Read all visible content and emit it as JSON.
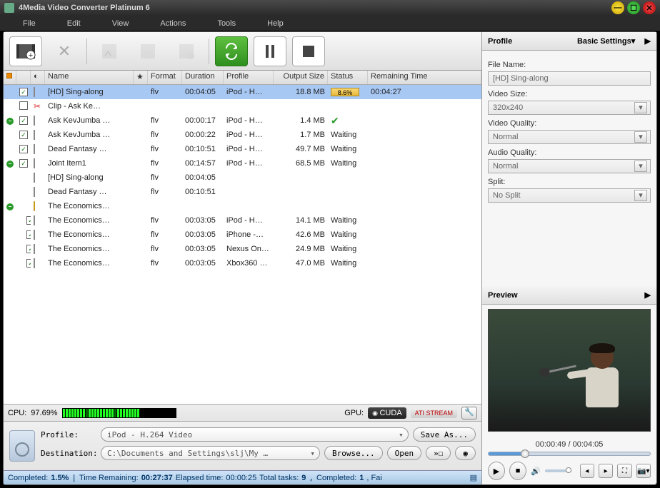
{
  "app": {
    "title": "4Media Video Converter Platinum 6"
  },
  "menu": {
    "file": "File",
    "edit": "Edit",
    "view": "View",
    "actions": "Actions",
    "tools": "Tools",
    "help": "Help"
  },
  "columns": {
    "name": "Name",
    "format": "Format",
    "duration": "Duration",
    "profile": "Profile",
    "output_size": "Output Size",
    "status": "Status",
    "remaining": "Remaining Time"
  },
  "rows": [
    {
      "exp": "",
      "chk": true,
      "type": "doc",
      "name": "[HD] Sing-along",
      "fmt": "flv",
      "dur": "00:04:05",
      "prof": "iPod - H…",
      "size": "18.8 MB",
      "stat_pct": "8.6%",
      "rem": "00:04:27",
      "sel": true
    },
    {
      "exp": "",
      "chk": false,
      "type": "scissor",
      "name": "Clip - Ask Ke…",
      "fmt": "",
      "dur": "",
      "prof": "",
      "size": "",
      "stat": "",
      "rem": ""
    },
    {
      "exp": "minus",
      "chk": true,
      "type": "doc",
      "name": "Ask KevJumba …",
      "fmt": "flv",
      "dur": "00:00:17",
      "prof": "iPod - H…",
      "size": "1.4 MB",
      "stat_ok": true,
      "rem": ""
    },
    {
      "exp": "",
      "chk": true,
      "type": "doc",
      "name": "Ask KevJumba …",
      "fmt": "flv",
      "dur": "00:00:22",
      "prof": "iPod - H…",
      "size": "1.7 MB",
      "stat": "Waiting",
      "rem": ""
    },
    {
      "exp": "",
      "chk": true,
      "type": "doc",
      "name": "Dead Fantasy …",
      "fmt": "flv",
      "dur": "00:10:51",
      "prof": "iPod - H…",
      "size": "49.7 MB",
      "stat": "Waiting",
      "rem": ""
    },
    {
      "exp": "minus",
      "chk": true,
      "type": "doc",
      "name": "Joint Item1",
      "fmt": "flv",
      "dur": "00:14:57",
      "prof": "iPod - H…",
      "size": "68.5 MB",
      "stat": "Waiting",
      "rem": ""
    },
    {
      "exp": "",
      "chk": false,
      "type": "doc",
      "name": "[HD] Sing-along",
      "fmt": "flv",
      "dur": "00:04:05",
      "prof": "",
      "size": "",
      "stat": "",
      "rem": "",
      "nochk": true
    },
    {
      "exp": "",
      "chk": false,
      "type": "doc",
      "name": "Dead Fantasy …",
      "fmt": "flv",
      "dur": "00:10:51",
      "prof": "",
      "size": "",
      "stat": "",
      "rem": "",
      "nochk": true
    },
    {
      "exp": "minus",
      "chk": false,
      "type": "folder",
      "name": "The Economics…",
      "fmt": "",
      "dur": "",
      "prof": "",
      "size": "",
      "stat": "",
      "rem": "",
      "nochk": true
    },
    {
      "exp": "",
      "chk": true,
      "type": "doc",
      "name": "The Economics…",
      "fmt": "flv",
      "dur": "00:03:05",
      "prof": "iPod - H…",
      "size": "14.1 MB",
      "stat": "Waiting",
      "rem": "",
      "indent": true
    },
    {
      "exp": "",
      "chk": true,
      "type": "doc",
      "name": "The Economics…",
      "fmt": "flv",
      "dur": "00:03:05",
      "prof": "iPhone -…",
      "size": "42.6 MB",
      "stat": "Waiting",
      "rem": "",
      "indent": true
    },
    {
      "exp": "",
      "chk": true,
      "type": "doc",
      "name": "The Economics…",
      "fmt": "flv",
      "dur": "00:03:05",
      "prof": "Nexus On…",
      "size": "24.9 MB",
      "stat": "Waiting",
      "rem": "",
      "indent": true
    },
    {
      "exp": "",
      "chk": true,
      "type": "doc",
      "name": "The Economics…",
      "fmt": "flv",
      "dur": "00:03:05",
      "prof": "Xbox360 …",
      "size": "47.0 MB",
      "stat": "Waiting",
      "rem": "",
      "indent": true
    }
  ],
  "cpu": {
    "label": "CPU:",
    "value": "97.69%"
  },
  "gpu": {
    "label": "GPU:",
    "cuda": "CUDA",
    "ati": "ATI STREAM"
  },
  "lower": {
    "profile_label": "Profile:",
    "profile_value": "iPod - H.264 Video",
    "save_as": "Save As...",
    "dest_label": "Destination:",
    "dest_value": "C:\\Documents and Settings\\slj\\My …",
    "browse": "Browse...",
    "open": "Open"
  },
  "status": {
    "completed_label": "Completed:",
    "completed_pct": "1.5%",
    "time_rem_label": "Time Remaining:",
    "time_rem": "00:27:37",
    "elapsed_label": "Elapsed time:",
    "elapsed": "00:00:25",
    "total_label": "Total tasks:",
    "total": "9",
    "comp_label": "Completed:",
    "comp": "1",
    "tail": ", Fai"
  },
  "profile_panel": {
    "header": "Profile",
    "basic": "Basic Settings",
    "file_name_label": "File Name:",
    "file_name": "[HD] Sing-along",
    "video_size_label": "Video Size:",
    "video_size": "320x240",
    "video_quality_label": "Video Quality:",
    "video_quality": "Normal",
    "audio_quality_label": "Audio Quality:",
    "audio_quality": "Normal",
    "split_label": "Split:",
    "split": "No Split"
  },
  "preview": {
    "header": "Preview",
    "time": "00:00:49 / 00:04:05"
  }
}
